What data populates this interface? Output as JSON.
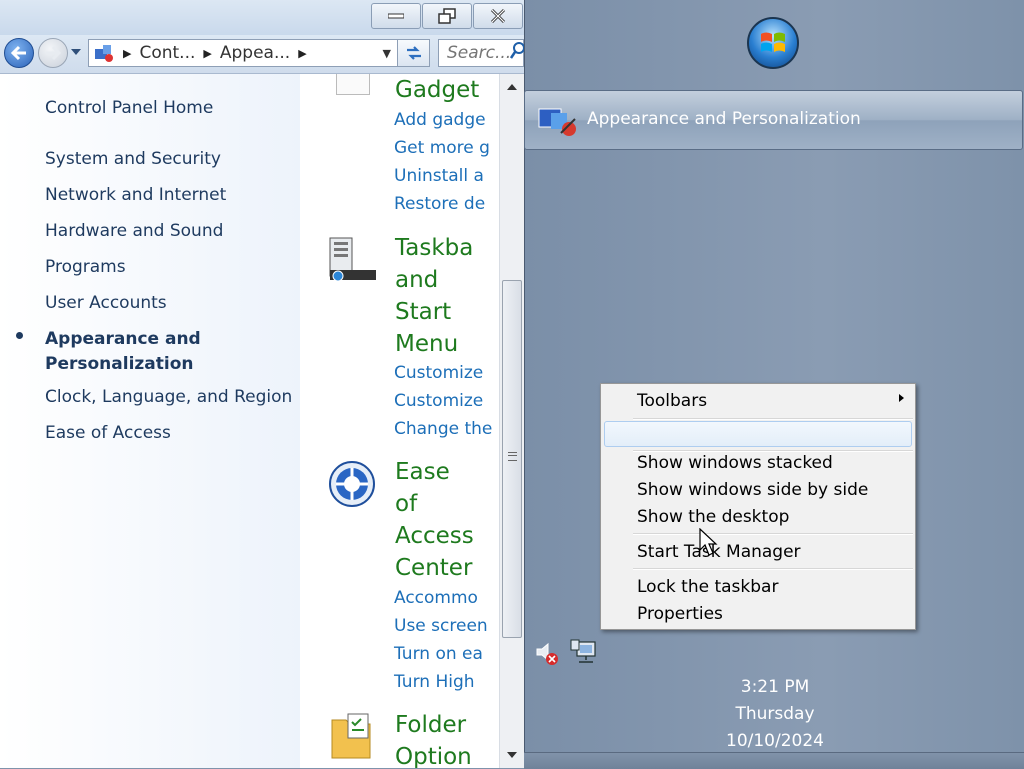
{
  "window": {
    "address": {
      "crumbs": [
        "Cont...",
        "Appea..."
      ]
    },
    "search": {
      "placeholder": "Searc..."
    }
  },
  "sidebar": {
    "home": "Control Panel Home",
    "items": [
      {
        "label": "System and Security"
      },
      {
        "label": "Network and Internet"
      },
      {
        "label": "Hardware and Sound"
      },
      {
        "label": "Programs"
      },
      {
        "label": "User Accounts"
      },
      {
        "label": "Appearance and",
        "label2": "Personalization",
        "active": true
      },
      {
        "label": "Clock, Language, and Region"
      },
      {
        "label": "Ease of Access"
      }
    ]
  },
  "main": {
    "gadgets": {
      "title": "Gadget",
      "links": [
        "Add gadge",
        "Get more g",
        "Uninstall a",
        "Restore de"
      ]
    },
    "taskbar": {
      "title": [
        "Taskba",
        "and",
        "Start",
        "Menu"
      ],
      "links": [
        "Customize",
        "Customize",
        "Change the"
      ]
    },
    "ease": {
      "title": [
        "Ease",
        "of",
        "Access",
        "Center"
      ],
      "links": [
        "Accommo",
        "Use screen",
        "Turn on ea",
        "Turn High"
      ]
    },
    "folder": {
      "title": [
        "Folder",
        "Option"
      ]
    }
  },
  "taskbar": {
    "window_button": "Appearance and Personalization",
    "clock": {
      "time": "3:21 PM",
      "day": "Thursday",
      "date": "10/10/2024"
    }
  },
  "context_menu": {
    "toolbars": "Toolbars",
    "stacked": "Show windows stacked",
    "side_by_side": "Show windows side by side",
    "show_desktop": "Show the desktop",
    "task_manager": "Start Task Manager",
    "lock": "Lock the taskbar",
    "properties": "Properties"
  },
  "colors": {
    "link": "#1d6fb8",
    "category_title": "#1e7a1e",
    "desktop": "#7f93ab"
  }
}
